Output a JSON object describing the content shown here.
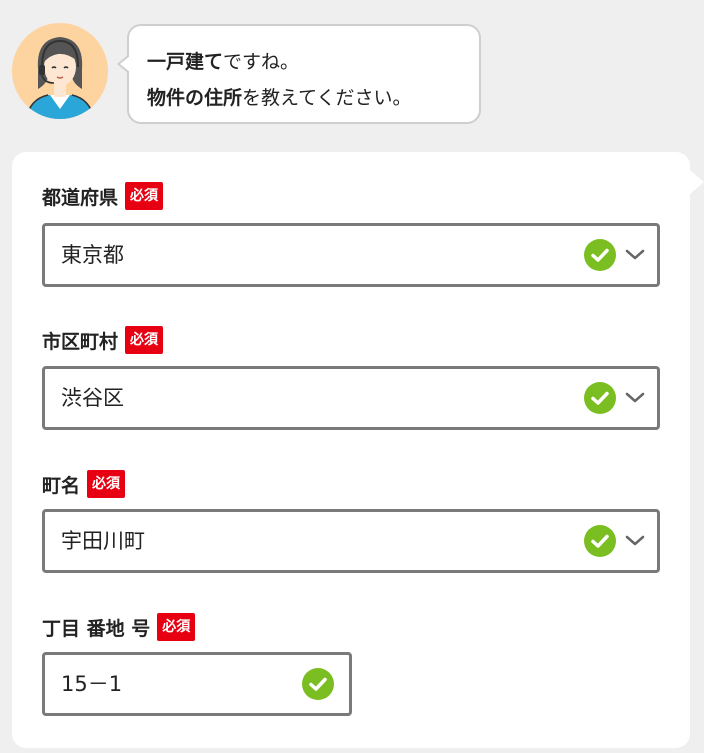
{
  "assistant": {
    "line1_bold": "一戸建て",
    "line1_rest": "ですね。",
    "line2_bold": "物件の住所",
    "line2_rest": "を教えてください。",
    "avatar_icon": "operator-avatar-icon"
  },
  "form": {
    "required_label": "必須",
    "prefecture": {
      "label": "都道府県",
      "value": "東京都"
    },
    "city": {
      "label": "市区町村",
      "value": "渋谷区"
    },
    "town": {
      "label": "町名",
      "value": "宇田川町"
    },
    "block": {
      "label": "丁目 番地 号",
      "value": "15－1"
    }
  },
  "colors": {
    "required_badge": "#e60012",
    "valid_check": "#7bbe22",
    "field_border": "#7a7a7a",
    "page_bg": "#efefef"
  }
}
